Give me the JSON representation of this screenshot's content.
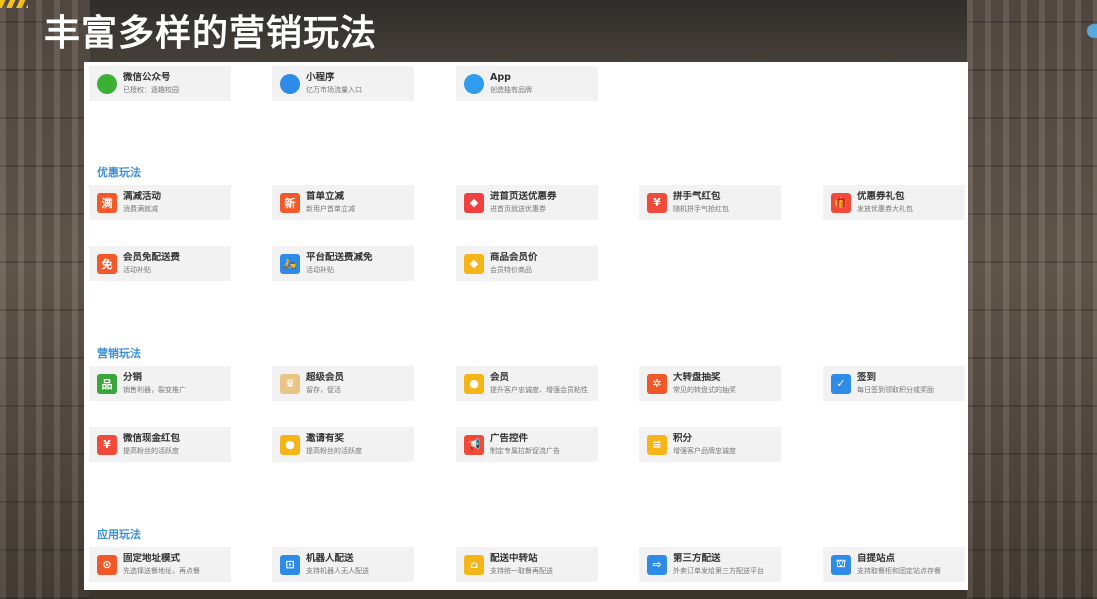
{
  "title": "丰富多样的营销玩法",
  "top_row": [
    {
      "name": "微信公众号",
      "desc": "已授权：逐趣校园",
      "icon": "wechat-icon",
      "color": "#3cb034"
    },
    {
      "name": "小程序",
      "desc": "亿万市场流量入口",
      "icon": "mini-program-icon",
      "color": "#2e8be8"
    },
    {
      "name": "App",
      "desc": "创造独有品牌",
      "icon": "app-icon",
      "color": "#2f9cf0"
    }
  ],
  "sections": [
    {
      "title": "优惠玩法",
      "rows": [
        [
          {
            "name": "满减活动",
            "desc": "消费满就减",
            "icon": "full-reduction-icon",
            "glyph": "满",
            "color": "#f2592a"
          },
          {
            "name": "首单立减",
            "desc": "新用户首单立减",
            "icon": "first-order-icon",
            "glyph": "新",
            "color": "#f2592a"
          },
          {
            "name": "进首页送优惠券",
            "desc": "进首页就送优惠券",
            "icon": "coupon-tag-icon",
            "glyph": "◆",
            "color": "#f04040"
          },
          {
            "name": "拼手气红包",
            "desc": "随机拼手气抢红包",
            "icon": "red-packet-icon",
            "glyph": "¥",
            "color": "#f04a3a"
          },
          {
            "name": "优惠券礼包",
            "desc": "发放优惠券大礼包",
            "icon": "gift-icon",
            "glyph": "🎁",
            "color": "#f04a3a"
          }
        ],
        [
          {
            "name": "会员免配送费",
            "desc": "活动补贴",
            "icon": "free-delivery-icon",
            "glyph": "免",
            "color": "#f2592a"
          },
          {
            "name": "平台配送费减免",
            "desc": "活动补贴",
            "icon": "scooter-icon",
            "glyph": "🛵",
            "color": "#2e8be8"
          },
          {
            "name": "商品会员价",
            "desc": "会员特价商品",
            "icon": "diamond-icon",
            "glyph": "◆",
            "color": "#f5b417"
          }
        ]
      ]
    },
    {
      "title": "营销玩法",
      "rows": [
        [
          {
            "name": "分销",
            "desc": "销售利器，裂变推广",
            "icon": "distribution-icon",
            "glyph": "品",
            "color": "#3aa53a"
          },
          {
            "name": "超级会员",
            "desc": "留存，促活",
            "icon": "crown-icon",
            "glyph": "♛",
            "color": "#e8c487"
          },
          {
            "name": "会员",
            "desc": "提升客户忠诚度、增强会员粘性",
            "icon": "member-icon",
            "glyph": "●",
            "color": "#f5b417"
          },
          {
            "name": "大转盘抽奖",
            "desc": "常见的转盘式的抽奖",
            "icon": "wheel-icon",
            "glyph": "✲",
            "color": "#f0582a"
          },
          {
            "name": "签到",
            "desc": "每日签到领取积分或奖励",
            "icon": "checkin-icon",
            "glyph": "✓",
            "color": "#2e8be8"
          }
        ],
        [
          {
            "name": "微信现金红包",
            "desc": "提高粉丝的活跃度",
            "icon": "cash-red-packet-icon",
            "glyph": "¥",
            "color": "#f04a3a"
          },
          {
            "name": "邀请有奖",
            "desc": "提高粉丝的活跃度",
            "icon": "invite-icon",
            "glyph": "●",
            "color": "#f5b417"
          },
          {
            "name": "广告控件",
            "desc": "制定专属拉新促流广告",
            "icon": "megaphone-icon",
            "glyph": "📢",
            "color": "#f04a3a"
          },
          {
            "name": "积分",
            "desc": "增强客户品牌忠诚度",
            "icon": "points-icon",
            "glyph": "≡",
            "color": "#f5b417"
          }
        ]
      ]
    },
    {
      "title": "应用玩法",
      "rows": [
        [
          {
            "name": "固定地址模式",
            "desc": "先选择送餐地址，再点餐",
            "icon": "location-pin-icon",
            "glyph": "⊙",
            "color": "#f0582a"
          },
          {
            "name": "机器人配送",
            "desc": "支持机器人无人配送",
            "icon": "robot-icon",
            "glyph": "⊡",
            "color": "#2e8be8"
          },
          {
            "name": "配送中转站",
            "desc": "支持统一取餐再配送",
            "icon": "transfer-station-icon",
            "glyph": "⌂",
            "color": "#f5b417"
          },
          {
            "name": "第三方配送",
            "desc": "外卖订单发给第三方配送平台",
            "icon": "third-party-delivery-icon",
            "glyph": "⇨",
            "color": "#2e8be8"
          },
          {
            "name": "自提站点",
            "desc": "支持取餐柜和固定站点存餐",
            "icon": "pickup-station-icon",
            "glyph": "⛫",
            "color": "#2e8be8"
          }
        ]
      ]
    }
  ]
}
